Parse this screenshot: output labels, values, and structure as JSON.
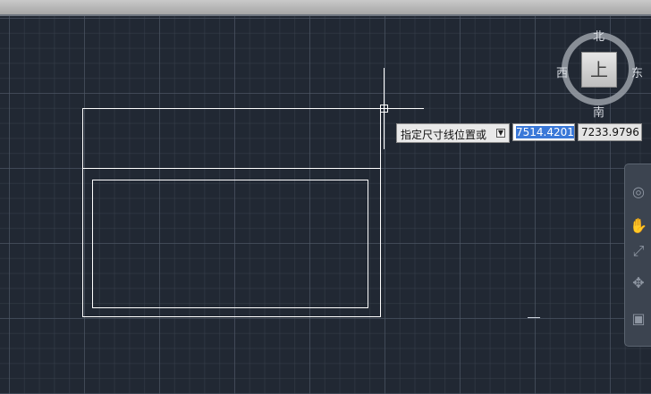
{
  "viewcube": {
    "face": "上",
    "north": "北",
    "south": "南",
    "west": "西",
    "east": "东"
  },
  "command": {
    "prompt": "指定尺寸线位置或",
    "x_value": "7514.4201",
    "y_value": "7233.9796"
  },
  "nav_icons": [
    "steering-wheel-icon",
    "pan-icon",
    "zoom-icon",
    "orbit-icon",
    "showmotion-icon"
  ]
}
